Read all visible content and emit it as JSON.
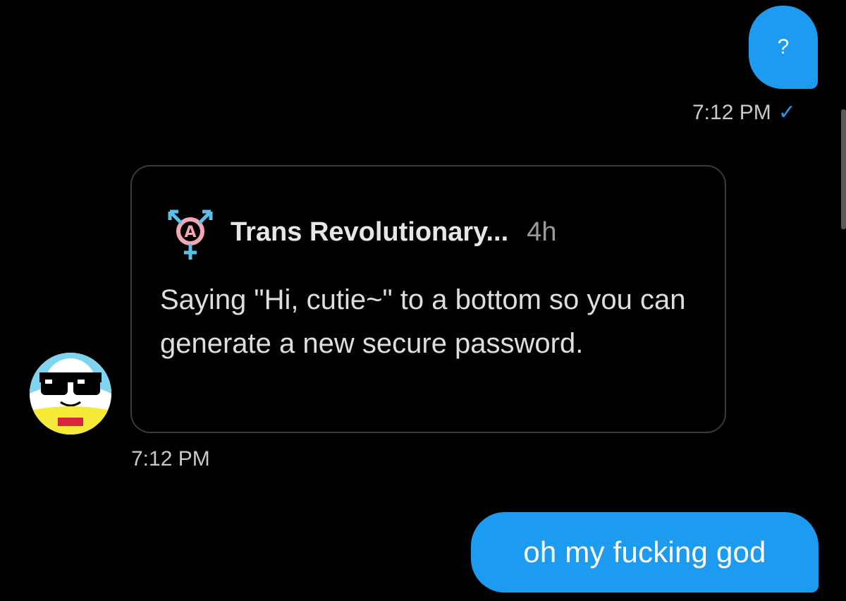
{
  "messages": {
    "sent_question": {
      "text": "?",
      "time": "7:12 PM",
      "status_icon": "check-icon"
    },
    "shared_post": {
      "author": "Trans Revolutionary...",
      "age": "4h",
      "text": "Saying \"Hi, cutie~\" to a bottom so you can generate a new secure password.",
      "time": "7:12 PM"
    },
    "sent_reply": {
      "text": "oh my fucking god"
    }
  },
  "colors": {
    "background": "#000000",
    "outgoing_bubble": "#1d9bf0",
    "card_border": "#3a3a3a"
  }
}
